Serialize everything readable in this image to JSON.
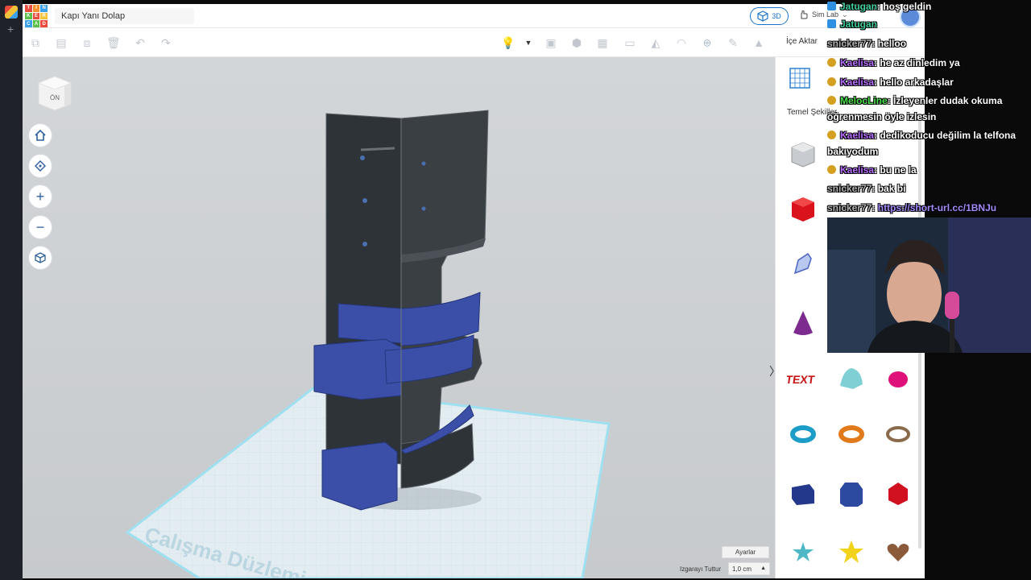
{
  "os_strip": {
    "add_icon": "+"
  },
  "app": {
    "logo_letters": [
      "TIN",
      "KER",
      "CAD"
    ],
    "logo_colors": [
      "#e94b3c",
      "#f3912d",
      "#3aa0e9",
      "#5cbf4a",
      "#e94b3c",
      "#f3c13a",
      "#3aa0e9",
      "#5cbf4a",
      "#e94b3c"
    ],
    "design_name": "Kapı Yanı Dolap",
    "view_3d_label": "3D",
    "sim_lab_label": "Sim Lab",
    "import_label": "İçe Aktar"
  },
  "viewport": {
    "viewcube_label": "ÖN",
    "workplane_label": "Çalışma Düzlemi",
    "settings_button": "Ayarlar",
    "snap_grid_label": "Izgarayı Tuttur",
    "snap_grid_value": "1,0 cm"
  },
  "shapes_panel": {
    "category_label": "Temel Şekiller",
    "shapes": [
      "box-hole",
      "box",
      "scribble",
      "cone",
      "text",
      "roof",
      "paraboloid",
      "torus",
      "tube",
      "ring",
      "cube",
      "polygon",
      "gem",
      "star",
      "star-gold",
      "heart"
    ]
  },
  "chat": [
    {
      "user": "Jatugan",
      "user_color": "#3fcfa0",
      "badge": "bot",
      "text": ": hoş geldin"
    },
    {
      "user": "Jatugan",
      "user_color": "#3fcfa0",
      "badge": "bot",
      "text": ""
    },
    {
      "user": "snicker77",
      "user_color": "#b0b0b0",
      "badge": "",
      "text": ": helloo"
    },
    {
      "user": "Kaelisa",
      "user_color": "#b66cff",
      "badge": "q",
      "text": ": he az dinledim ya"
    },
    {
      "user": "Kaelisa",
      "user_color": "#b66cff",
      "badge": "q",
      "text": ": hello arkadaşlar"
    },
    {
      "user": "MelocLine",
      "user_color": "#4be34b",
      "badge": "q",
      "text": ": İzleyenler dudak okuma"
    },
    {
      "user": "",
      "user_color": "#fff",
      "badge": "",
      "text": "öğrenmesin öyle izlesin"
    },
    {
      "user": "Kaelisa",
      "user_color": "#b66cff",
      "badge": "q",
      "text": ": dedikoducu değilim la telfona"
    },
    {
      "user": "",
      "user_color": "#fff",
      "badge": "",
      "text": "bakıyodum"
    },
    {
      "user": "Kaelisa",
      "user_color": "#b66cff",
      "badge": "q",
      "text": ": bu ne la"
    },
    {
      "user": "snicker77",
      "user_color": "#b0b0b0",
      "badge": "",
      "text": ": bak bi"
    },
    {
      "user": "snicker77",
      "user_color": "#b0b0b0",
      "badge": "",
      "text": ": "
    },
    {
      "user": "",
      "user_color": "#fff",
      "badge": "",
      "text": ""
    }
  ],
  "chat_link": "https://short-url.cc/1BNJu"
}
